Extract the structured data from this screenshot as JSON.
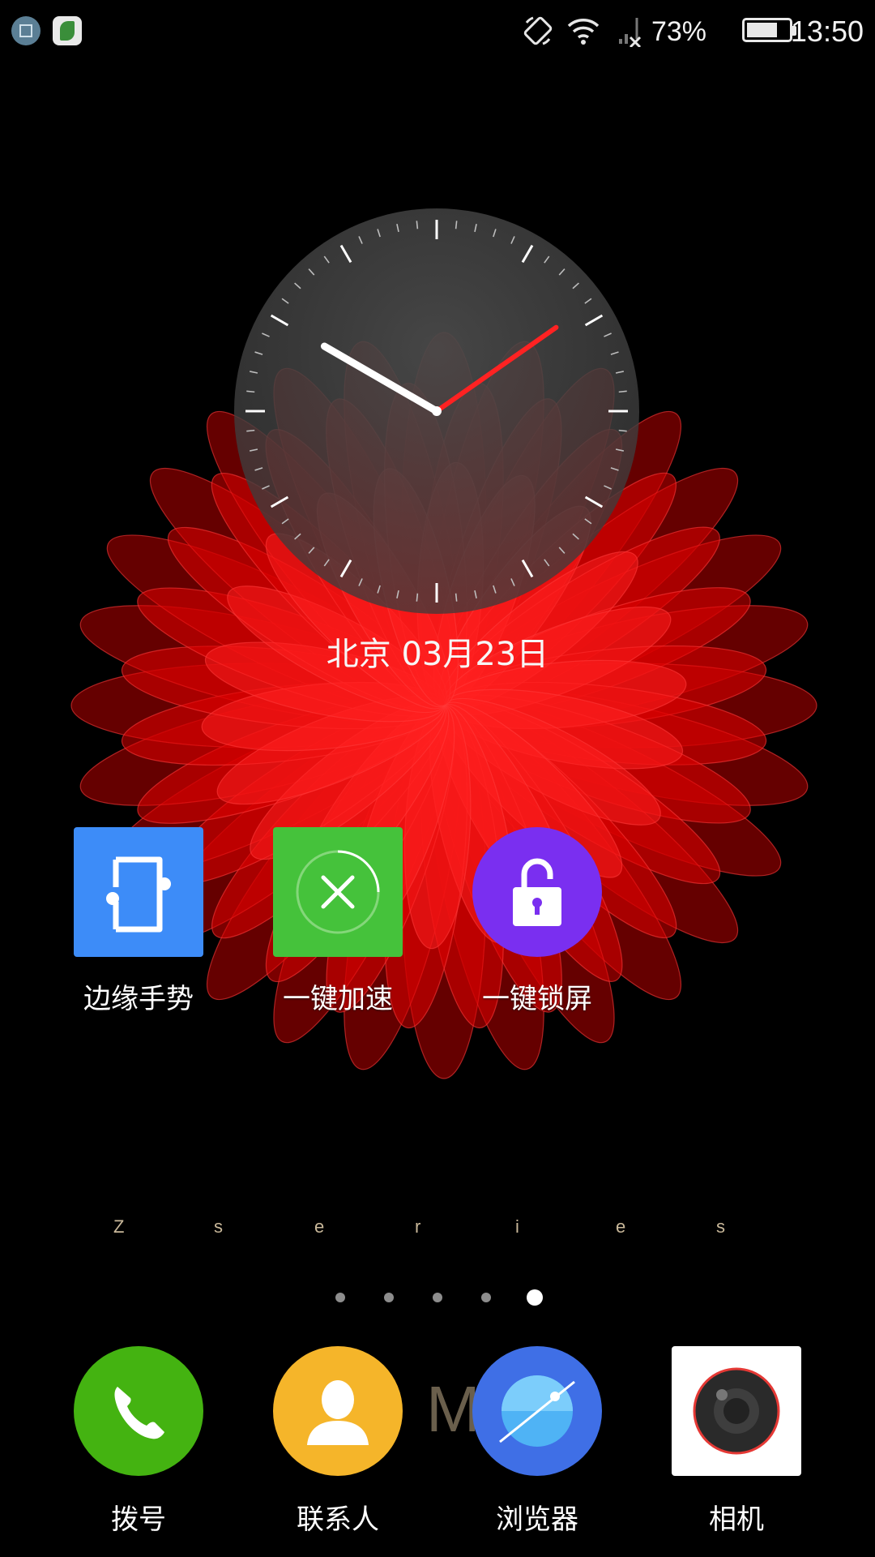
{
  "status_bar": {
    "notifications": [
      {
        "icon": "screenshot-icon"
      },
      {
        "icon": "launcher-app-icon"
      }
    ],
    "icons": [
      "rotation-lock-icon",
      "wifi-icon",
      "no-signal-icon"
    ],
    "battery_percent": "73%",
    "battery_level": 0.73,
    "time": "13:50"
  },
  "clock_widget": {
    "time_shown": "13:50",
    "date_text": "北京 03月23日"
  },
  "shortcuts": [
    {
      "label": "边缘手势",
      "icon": "edge-gesture-icon",
      "color": "#3d8cf8"
    },
    {
      "label": "一键加速",
      "icon": "boost-icon",
      "color": "#45c23b"
    },
    {
      "label": "一键锁屏",
      "icon": "lock-icon",
      "color": "#7a2ff0"
    }
  ],
  "wallpaper_text": {
    "letters": [
      "Z",
      "s",
      "e",
      "r",
      "i",
      "e",
      "s"
    ],
    "dock_watermark": "M"
  },
  "pager": {
    "count": 5,
    "active_index": 4
  },
  "dock": [
    {
      "label": "拨号",
      "icon": "phone-icon",
      "color": "#44b311"
    },
    {
      "label": "联系人",
      "icon": "contacts-icon",
      "color": "#f5b52a"
    },
    {
      "label": "浏览器",
      "icon": "browser-icon",
      "color": "#3f6fe6"
    },
    {
      "label": "相机",
      "icon": "camera-icon",
      "color": "#ffffff"
    }
  ],
  "colors": {
    "flower_red": "#ff1a1a",
    "background": "#000000"
  }
}
